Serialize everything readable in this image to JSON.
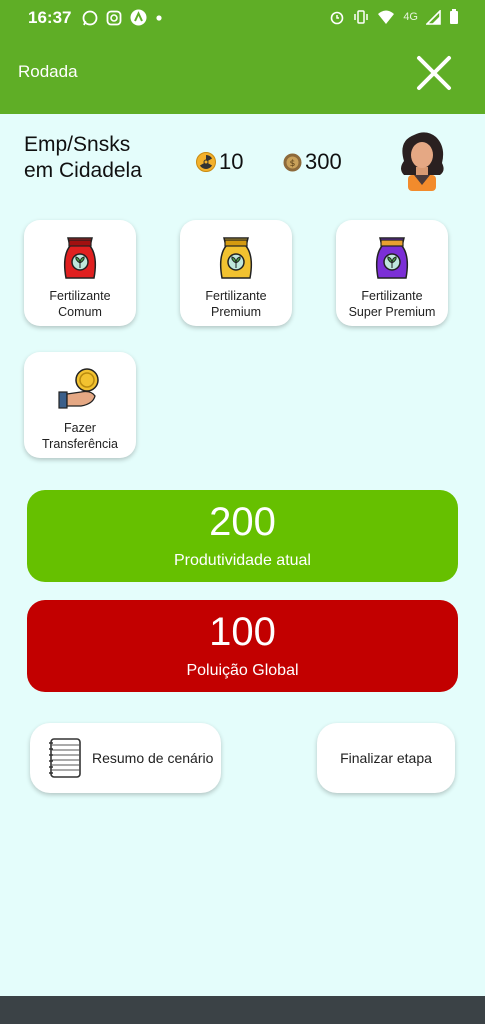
{
  "status_bar": {
    "time": "16:37",
    "network": "4G",
    "left_icons": [
      "whatsapp-icon",
      "instagram-icon",
      "app-icon",
      "dot-icon"
    ],
    "right_icons": [
      "alarm-icon",
      "vibrate-icon",
      "wifi-icon",
      "signal-icon",
      "battery-icon"
    ]
  },
  "app_bar": {
    "title": "Rodada",
    "close_icon": "close-icon",
    "background": "#5fae26"
  },
  "player": {
    "name": "Emp/Snsks\nem Cidadela",
    "pollution_points": "10",
    "coins": "300",
    "avatar": "woman-avatar-icon"
  },
  "actions": [
    {
      "label": "Fertilizante\nComum",
      "icon": "red-fertilizer-bag-icon",
      "color": "#e02020"
    },
    {
      "label": "Fertilizante\nPremium",
      "icon": "yellow-fertilizer-bag-icon",
      "color": "#f2c230"
    },
    {
      "label": "Fertilizante\nSuper Premium",
      "icon": "purple-fertilizer-bag-icon",
      "color": "#7b2fd6"
    },
    {
      "label": "Fazer\nTransferência",
      "icon": "coin-hand-icon"
    }
  ],
  "productivity": {
    "value": "200",
    "label": "Produtividade atual",
    "color": "#66c000"
  },
  "pollution": {
    "value": "100",
    "label": "Poluição Global",
    "color": "#c20000"
  },
  "buttons": {
    "summary": "Resumo de cenário",
    "finish": "Finalizar etapa"
  }
}
